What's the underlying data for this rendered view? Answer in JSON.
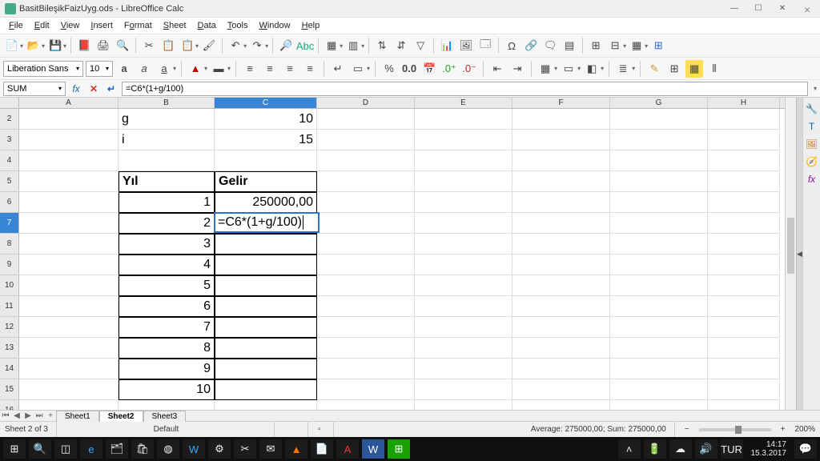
{
  "title": "BasitBileşikFaizUyg.ods - LibreOffice Calc",
  "menu": {
    "file": "File",
    "edit": "Edit",
    "view": "View",
    "insert": "Insert",
    "format": "Format",
    "sheet": "Sheet",
    "data": "Data",
    "tools": "Tools",
    "window": "Window",
    "help": "Help"
  },
  "font": {
    "name": "Liberation Sans",
    "size": "10"
  },
  "namebox": "SUM",
  "formula": "=C6*(1+g/100)",
  "columns": [
    "A",
    "B",
    "C",
    "D",
    "E",
    "F",
    "G",
    "H"
  ],
  "rowStart": 2,
  "rowEnd": 16,
  "cells": {
    "B2": "g",
    "C2": "10",
    "B3": "i",
    "C3": "15",
    "B5": "Yıl",
    "C5": "Gelir",
    "B6": "1",
    "C6": "250000,00",
    "B7": "2",
    "B8": "3",
    "B9": "4",
    "B10": "5",
    "B11": "6",
    "B12": "7",
    "B13": "8",
    "B14": "9",
    "B15": "10"
  },
  "editing": {
    "ref": "C7",
    "text": "=C6*(1+g/100)"
  },
  "tabs": [
    "Sheet1",
    "Sheet2",
    "Sheet3"
  ],
  "activeTab": 1,
  "status": {
    "sheet": "Sheet 2 of 3",
    "style": "Default",
    "summary": "Average: 275000,00; Sum: 275000,00",
    "zoom": "200%"
  },
  "clock": {
    "time": "14:17",
    "date": "15.3.2017",
    "lang": "TUR"
  }
}
